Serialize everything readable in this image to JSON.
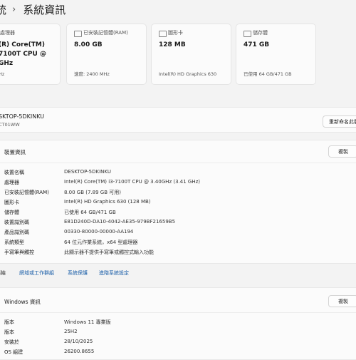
{
  "breadcrumb": {
    "parent": "統",
    "current": "系統資訊"
  },
  "cards": [
    {
      "label": "處理器",
      "value": "(R) Core(TM)\n7100T CPU @\nGHz",
      "sub": "Hz"
    },
    {
      "label": "已安裝記憶體(RAM)",
      "value": "8.00 GB",
      "sub": "速度: 2400 MHz"
    },
    {
      "label": "圖形卡",
      "value": "128 MB",
      "sub": "Intel(R) HD Graphics 630"
    },
    {
      "label": "儲存體",
      "value": "471 GB",
      "sub": "已使用 64 GB/471 GB"
    }
  ],
  "device_header": {
    "name": "SKTOP-5DKINKU",
    "model": "CT01WW",
    "rename_button": "重新命名此裝"
  },
  "device_spec": {
    "title": "裝置資訊",
    "copy_button": "複製",
    "rows": [
      {
        "key": "裝置名稱",
        "value": "DESKTOP-5DKINKU"
      },
      {
        "key": "處理器",
        "value": "Intel(R) Core(TM) i3-7100T CPU @ 3.40GHz (3.41 GHz)"
      },
      {
        "key": "已安裝記憶體(RAM)",
        "value": "8.00 GB (7.89 GB 可用)"
      },
      {
        "key": "圖形卡",
        "value": "Intel(R) HD Graphics 630 (128 MB)"
      },
      {
        "key": "儲存體",
        "value": "已使用 64 GB/471 GB"
      },
      {
        "key": "裝置識別碼",
        "value": "E81D240D-DA10-4042-AE35-979BF21659B5"
      },
      {
        "key": "產品識別碼",
        "value": "00330-80000-00000-AA194"
      },
      {
        "key": "系統類型",
        "value": "64 位元作業系統，x64 型處理器"
      },
      {
        "key": "手寫筆與觸控",
        "value": "此顯示器不提供手寫筆或觸控式輸入功能"
      }
    ]
  },
  "related_links": {
    "label": "連結",
    "links": [
      "網域或工作群組",
      "系統保護",
      "進階系統設定"
    ]
  },
  "windows_spec": {
    "title": "Windows 資訊",
    "copy_button": "複製",
    "rows": [
      {
        "key": "版本",
        "value": "Windows 11 專業版"
      },
      {
        "key": "版本",
        "value": "25H2"
      },
      {
        "key": "安裝於",
        "value": "28/10/2025"
      },
      {
        "key": "OS 組建",
        "value": "26200.8655"
      }
    ]
  }
}
